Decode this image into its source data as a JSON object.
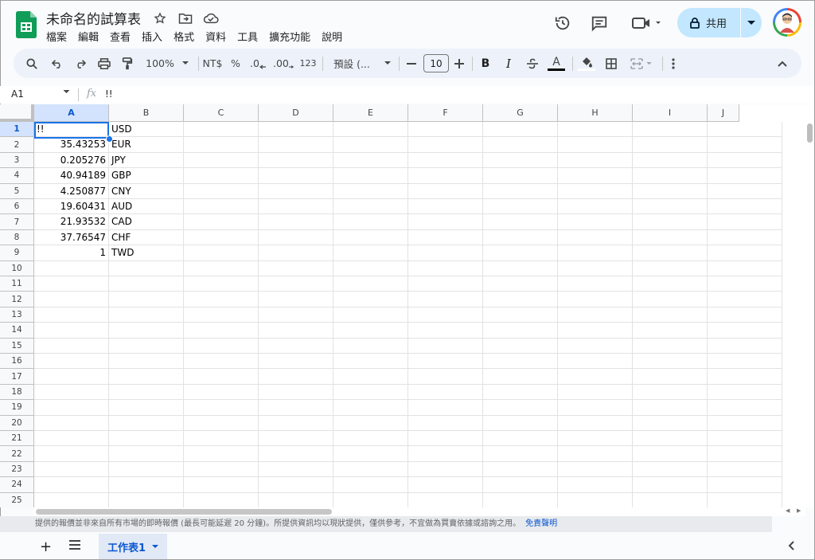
{
  "app": {
    "title": "未命名的試算表",
    "menu": [
      "檔案",
      "編輯",
      "查看",
      "插入",
      "格式",
      "資料",
      "工具",
      "擴充功能",
      "說明"
    ],
    "share_label": "共用"
  },
  "toolbar": {
    "zoom": "100%",
    "currency": "NT$",
    "percent": "%",
    "decrease_decimals": ".0",
    "increase_decimals": ".00",
    "number_format": "123",
    "font": "預設 (...",
    "font_size": "10",
    "bold": "B",
    "italic": "I",
    "text_color_letter": "A"
  },
  "formula_bar": {
    "name_box": "A1",
    "fx": "fx",
    "value": "!!"
  },
  "columns": [
    "A",
    "B",
    "C",
    "D",
    "E",
    "F",
    "G",
    "H",
    "I",
    "J"
  ],
  "rows": [
    "1",
    "2",
    "3",
    "4",
    "5",
    "6",
    "7",
    "8",
    "9",
    "10",
    "11",
    "12",
    "13",
    "14",
    "15",
    "16",
    "17",
    "18",
    "19",
    "20",
    "21",
    "22",
    "23",
    "24",
    "25"
  ],
  "cells": [
    {
      "a": "!!",
      "b": "USD"
    },
    {
      "a": "35.43253",
      "b": "EUR"
    },
    {
      "a": "0.205276",
      "b": "JPY"
    },
    {
      "a": "40.94189",
      "b": "GBP"
    },
    {
      "a": "4.250877",
      "b": "CNY"
    },
    {
      "a": "19.60431",
      "b": "AUD"
    },
    {
      "a": "21.93532",
      "b": "CAD"
    },
    {
      "a": "37.76547",
      "b": "CHF"
    },
    {
      "a": "1",
      "b": "TWD"
    }
  ],
  "status": {
    "text": "提供的報價並非來自所有市場的即時報價 (最長可能延遲 20 分鐘)。所提供資訊均以現狀提供，僅供參考，不宜做為買賣依據或諮詢之用。",
    "link": "免責聲明"
  },
  "sheets": {
    "active": "工作表1"
  },
  "colors": {
    "accent": "#1a73e8",
    "share_bg": "#c2e7ff",
    "selected_header": "#d3e3fd",
    "sheets_green": "#0f9d58"
  }
}
